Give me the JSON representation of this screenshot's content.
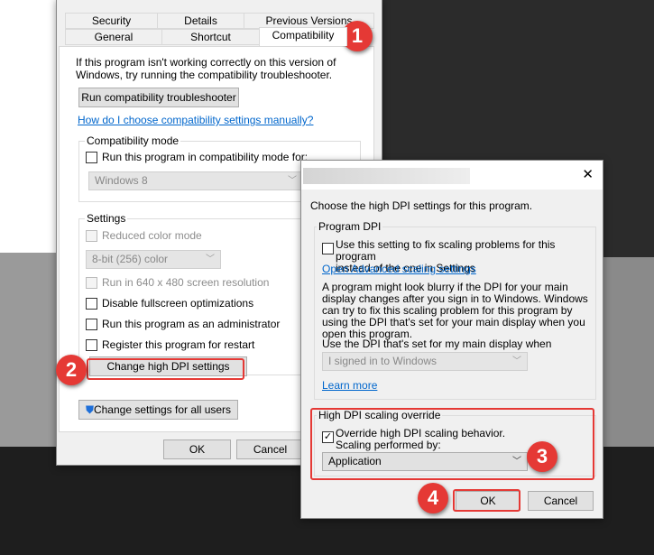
{
  "properties_dialog": {
    "tabs_row1": [
      "Security",
      "Details",
      "Previous Versions"
    ],
    "tabs_row2": [
      "General",
      "Shortcut",
      "Compatibility"
    ],
    "active_tab": "Compatibility",
    "intro": "If this program isn't working correctly on this version of Windows, try running the compatibility troubleshooter.",
    "troubleshooter_button": "Run compatibility troubleshooter",
    "help_link": "How do I choose compatibility settings manually?",
    "compat_mode": {
      "label": "Compatibility mode",
      "checkbox": "Run this program in compatibility mode for:",
      "checked": false,
      "select_value": "Windows 8"
    },
    "settings": {
      "label": "Settings",
      "reduced_color": "Reduced color mode",
      "color_select": "8-bit (256) color",
      "run_640": "Run in 640 x 480 screen resolution",
      "disable_fullscreen": "Disable fullscreen optimizations",
      "run_admin": "Run this program as an administrator",
      "register_restart": "Register this program for restart",
      "change_dpi_button": "Change high DPI settings"
    },
    "all_users_button": "Change settings for all users",
    "ok": "OK",
    "cancel": "Cancel"
  },
  "dpi_dialog": {
    "intro": "Choose the high DPI settings for this program.",
    "program_dpi": {
      "label": "Program DPI",
      "checkbox_line1": "Use this setting to fix scaling problems for this program",
      "checkbox_line2": "instead of the one in Settings",
      "checked": false,
      "advanced_link": "Open Advanced scaling settings",
      "description": "A program might look blurry if the DPI for your main display changes after you sign in to Windows. Windows can try to fix this scaling problem for this program by using the DPI that's set for your main display when you open this program.",
      "use_dpi_label": "Use the DPI that's set for my main display when",
      "use_dpi_select": "I signed in to Windows",
      "learn_more": "Learn more"
    },
    "override": {
      "label": "High DPI scaling override",
      "checkbox_line1": "Override high DPI scaling behavior.",
      "checkbox_line2": "Scaling performed by:",
      "checked": true,
      "select_value": "Application"
    },
    "ok": "OK",
    "cancel": "Cancel",
    "close": "✕"
  },
  "badges": [
    "1",
    "2",
    "3",
    "4"
  ],
  "colors": {
    "badge": "#e53935",
    "link": "#0066cc",
    "highlight": "#e53935"
  }
}
